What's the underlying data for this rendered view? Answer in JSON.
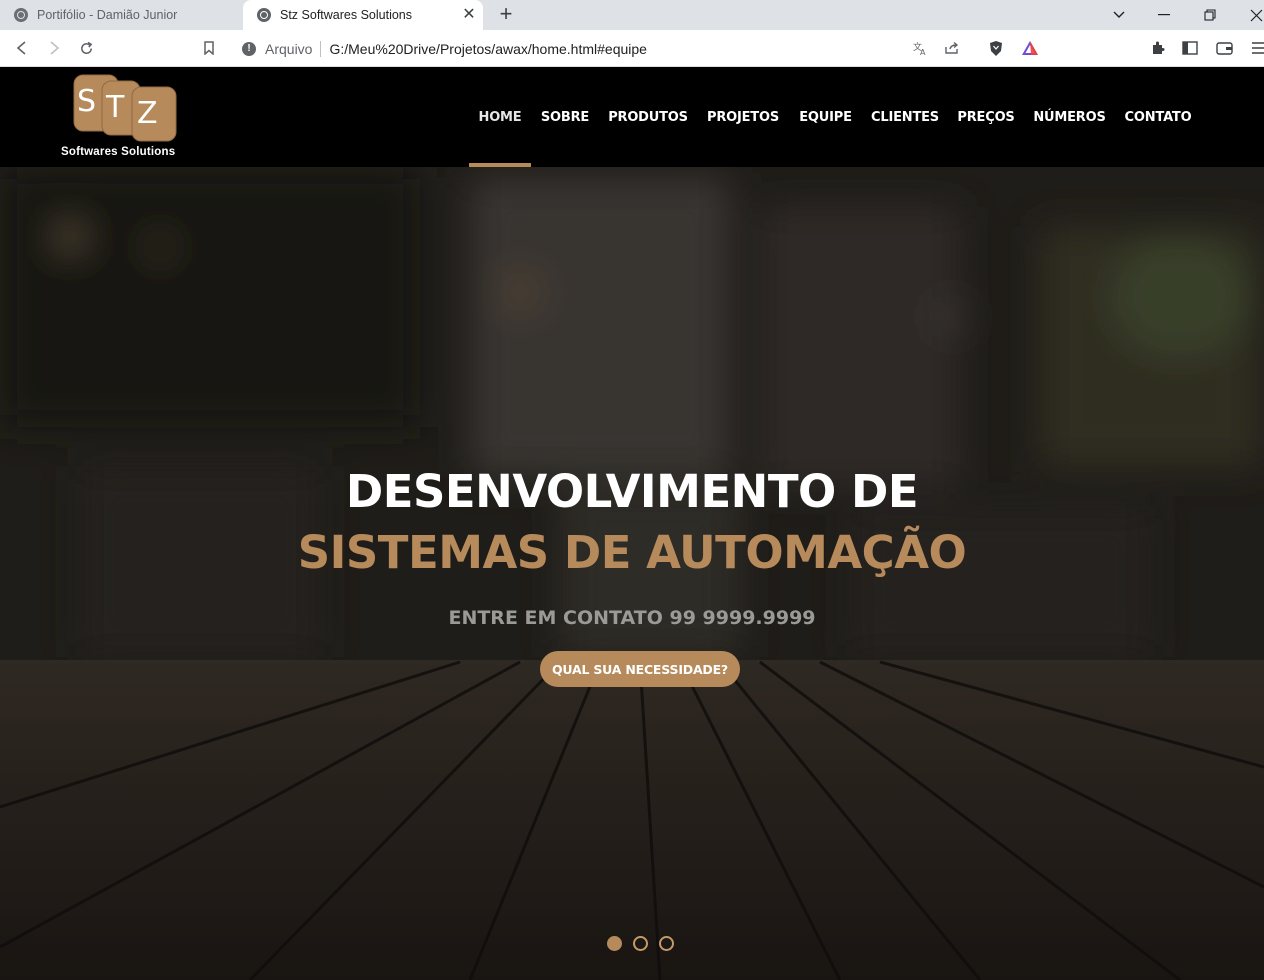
{
  "browser": {
    "tabs": [
      {
        "title": "Portifólio - Damião Junior",
        "active": false
      },
      {
        "title": "Stz Softwares Solutions",
        "active": true
      }
    ],
    "new_tab": "+",
    "window_controls": {
      "list": "⌄",
      "minimize": "—",
      "restore": "❐",
      "close": "✕"
    },
    "address": {
      "security_label": "Arquivo",
      "url": "G:/Meu%20Drive/Projetos/awax/home.html#equipe"
    }
  },
  "site": {
    "logo": {
      "letters": [
        "S",
        "T",
        "Z"
      ],
      "tagline": "Softwares Solutions"
    },
    "nav": [
      {
        "label": "HOME",
        "active": true
      },
      {
        "label": "SOBRE"
      },
      {
        "label": "PRODUTOS"
      },
      {
        "label": "PROJETOS"
      },
      {
        "label": "EQUIPE"
      },
      {
        "label": "CLIENTES"
      },
      {
        "label": "PREÇOS"
      },
      {
        "label": "NÚMEROS"
      },
      {
        "label": "CONTATO"
      }
    ],
    "hero": {
      "title_line1": "DESENVOLVIMENTO DE",
      "title_line2": "SISTEMAS DE AUTOMAÇÃO",
      "subtitle": "ENTRE EM CONTATO 99 9999.9999",
      "button": "QUAL SUA NECESSIDADE?",
      "slides": 3,
      "active_slide": 1
    },
    "colors": {
      "accent": "#b68a5b",
      "header_bg": "#000000",
      "text_light": "#ffffff"
    }
  }
}
